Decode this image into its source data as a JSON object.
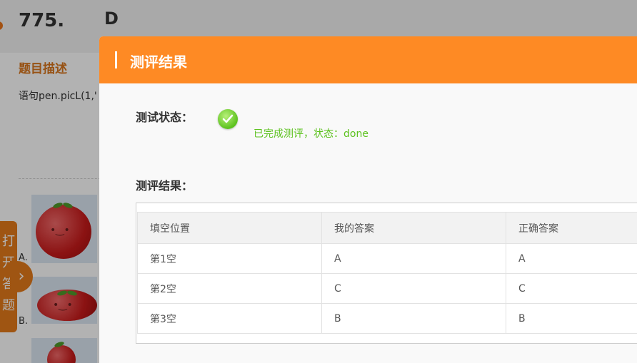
{
  "background": {
    "problem_number": "775.",
    "answer": "D",
    "section_title": "题目描述",
    "problem_text": "语句pen.picL(1,'",
    "options": [
      {
        "label": "A."
      },
      {
        "label": "B."
      }
    ],
    "side_tab_text": "打开答题",
    "expand_icon": "chevron-right-icon"
  },
  "modal": {
    "title": "测评结果",
    "status_label": "测试状态：",
    "status_icon": "check-circle-icon",
    "status_text": "已完成测评，状态：done",
    "result_label": "测评结果：",
    "table": {
      "headers": [
        "填空位置",
        "我的答案",
        "正确答案"
      ],
      "rows": [
        [
          "第1空",
          "A",
          "A"
        ],
        [
          "第2空",
          "C",
          "C"
        ],
        [
          "第3空",
          "B",
          "B"
        ]
      ]
    }
  },
  "colors": {
    "accent_orange": "#fe8a24",
    "side_orange": "#e47a1a",
    "success_green": "#5cc21e",
    "section_title": "#d8761e"
  }
}
